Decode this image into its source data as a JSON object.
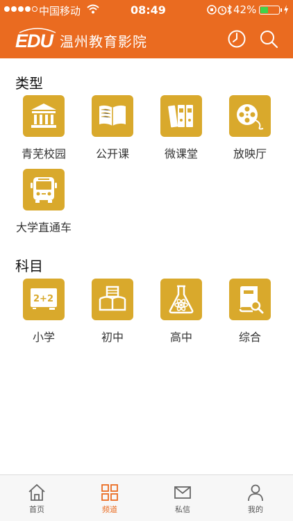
{
  "status_bar": {
    "carrier": "中国移动",
    "time": "08:49",
    "battery": "42%",
    "battery_fraction": 0.42
  },
  "header": {
    "logo_text": "EDU",
    "title": "温州教育影院",
    "history_icon": "clock-icon",
    "search_icon": "search-icon"
  },
  "sections": [
    {
      "title": "类型",
      "items": [
        {
          "label": "青芜校园",
          "icon": "school-building-icon"
        },
        {
          "label": "公开课",
          "icon": "open-book-icon"
        },
        {
          "label": "微课堂",
          "icon": "binders-icon"
        },
        {
          "label": "放映厅",
          "icon": "film-reel-icon"
        },
        {
          "label": "大学直通车",
          "icon": "bus-icon"
        }
      ]
    },
    {
      "title": "科目",
      "items": [
        {
          "label": "小学",
          "icon": "chalkboard-icon"
        },
        {
          "label": "初中",
          "icon": "bookshelf-icon"
        },
        {
          "label": "高中",
          "icon": "flask-atom-icon"
        },
        {
          "label": "综合",
          "icon": "book-search-icon"
        }
      ]
    }
  ],
  "tabbar": {
    "items": [
      {
        "label": "首页",
        "icon": "home-icon",
        "active": false
      },
      {
        "label": "频道",
        "icon": "grid-icon",
        "active": true
      },
      {
        "label": "私信",
        "icon": "mail-icon",
        "active": false
      },
      {
        "label": "我的",
        "icon": "user-icon",
        "active": false
      }
    ]
  },
  "colors": {
    "header_bg": "#ea6b20",
    "tile_bg": "#d9a92c",
    "active_tab": "#ea6b20"
  }
}
